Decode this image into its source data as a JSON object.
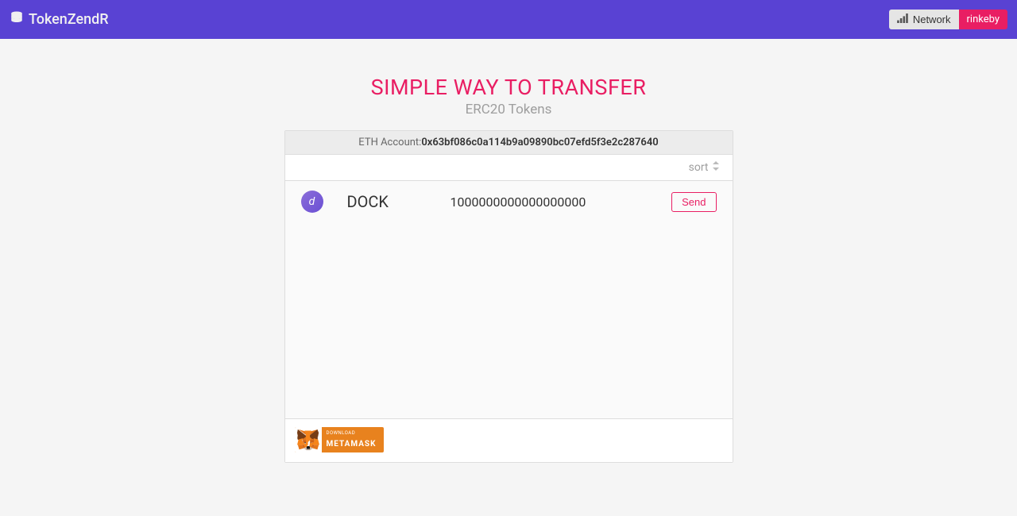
{
  "navbar": {
    "brand": "TokenZendR",
    "network_label": "Network",
    "network_name": "rinkeby"
  },
  "hero": {
    "title": "SIMPLE WAY TO TRANSFER",
    "subtitle": "ERC20 Tokens"
  },
  "account": {
    "label": "ETH Account:",
    "address": "0x63bf086c0a114b9a09890bc07efd5f3e2c287640"
  },
  "sort_label": "sort",
  "tokens": [
    {
      "symbol": "DOCK",
      "balance": "1000000000000000000",
      "send_label": "Send"
    }
  ],
  "footer": {
    "download_text": "DOWNLOAD",
    "metamask_text": "METAMASK"
  }
}
